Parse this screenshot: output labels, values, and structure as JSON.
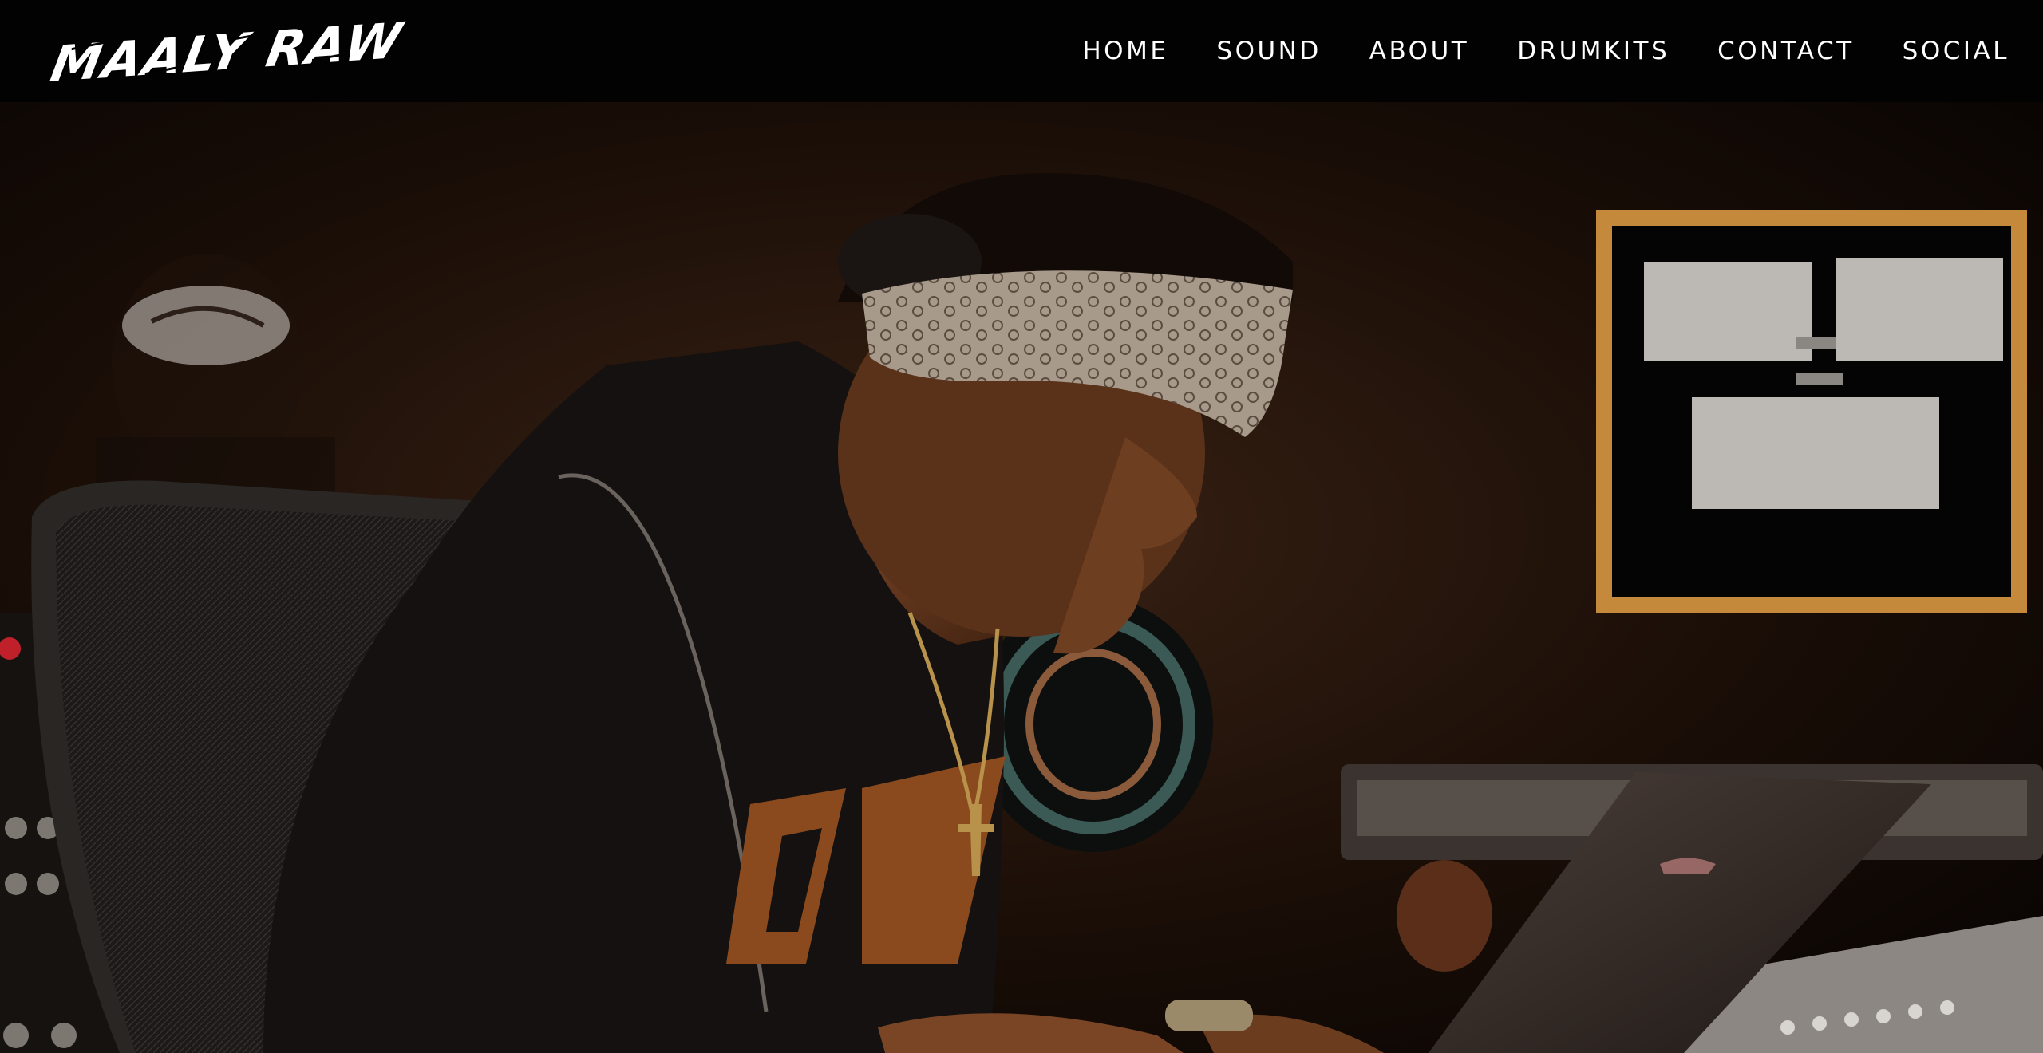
{
  "brand": {
    "logo_text": "MAALY RAW"
  },
  "nav": {
    "items": [
      {
        "label": "HOME"
      },
      {
        "label": "SOUND"
      },
      {
        "label": "ABOUT"
      },
      {
        "label": "DRUMKITS"
      },
      {
        "label": "CONTACT"
      },
      {
        "label": "SOCIAL"
      }
    ]
  },
  "colors": {
    "header_bg": "#020202",
    "nav_text": "#ffffff",
    "hero_tone": "#170d07"
  }
}
